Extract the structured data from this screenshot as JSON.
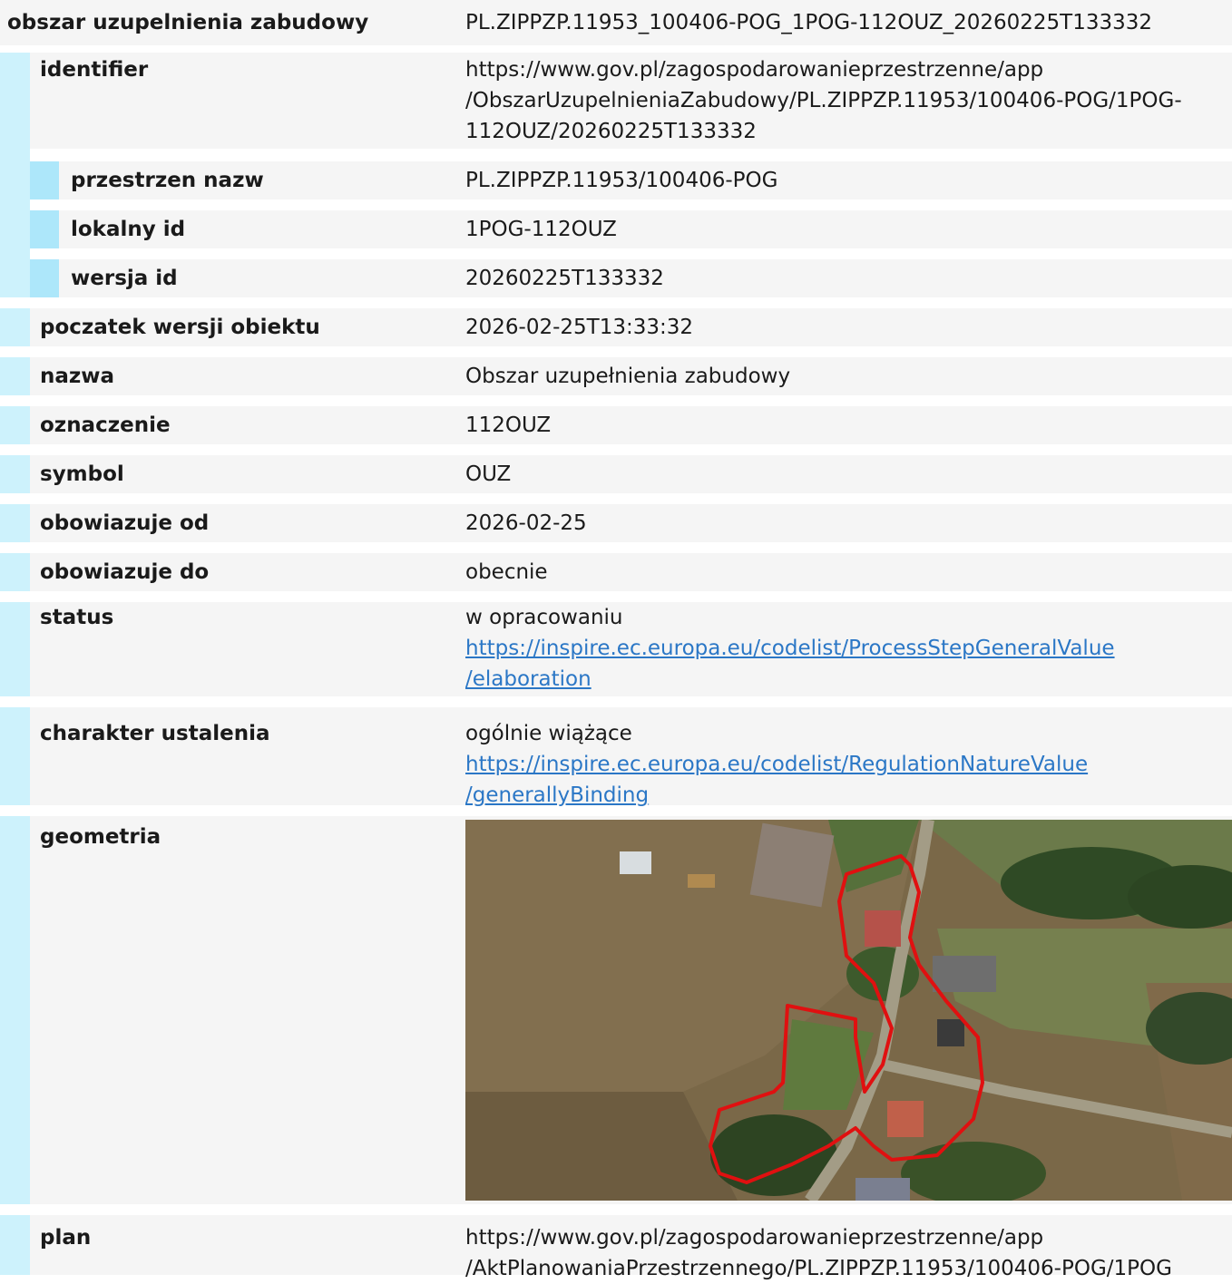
{
  "header": {
    "label": "obszar uzupelnienia zabudowy",
    "value": "PL.ZIPPZP.11953_100406-POG_1POG-112OUZ_20260225T133332"
  },
  "identifier": {
    "label": "identifier",
    "value": "https://www.gov.pl/zagospodarowanieprzestrzenne/app\n/ObszarUzupelnieniaZabudowy/PL.ZIPPZP.11953/100406-POG/1POG-\n112OUZ/20260225T133332",
    "sub": [
      {
        "label": "przestrzen nazw",
        "value": "PL.ZIPPZP.11953/100406-POG"
      },
      {
        "label": "lokalny id",
        "value": "1POG-112OUZ"
      },
      {
        "label": "wersja id",
        "value": "20260225T133332"
      }
    ]
  },
  "fields": [
    {
      "label": "poczatek wersji obiektu",
      "value": "2026-02-25T13:33:32"
    },
    {
      "label": "nazwa",
      "value": "Obszar uzupełnienia zabudowy"
    },
    {
      "label": "oznaczenie",
      "value": "112OUZ"
    },
    {
      "label": "symbol",
      "value": "OUZ"
    },
    {
      "label": "obowiazuje od",
      "value": "2026-02-25"
    },
    {
      "label": "obowiazuje do",
      "value": "obecnie"
    }
  ],
  "status": {
    "label": "status",
    "value": "w opracowaniu",
    "link_line1": "https://inspire.ec.europa.eu/codelist/ProcessStepGeneralValue",
    "link_line2": "/elaboration"
  },
  "charakter": {
    "label": "charakter ustalenia",
    "value": "ogólnie wiążące",
    "link_line1": "https://inspire.ec.europa.eu/codelist/RegulationNatureValue",
    "link_line2": "/generallyBinding"
  },
  "geometria": {
    "label": "geometria",
    "outline_color": "#e01010"
  },
  "plan": {
    "label": "plan",
    "value": "https://www.gov.pl/zagospodarowanieprzestrzenne/app\n/AktPlanowaniaPrzestrzennego/PL.ZIPPZP.11953/100406-POG/1POG"
  }
}
